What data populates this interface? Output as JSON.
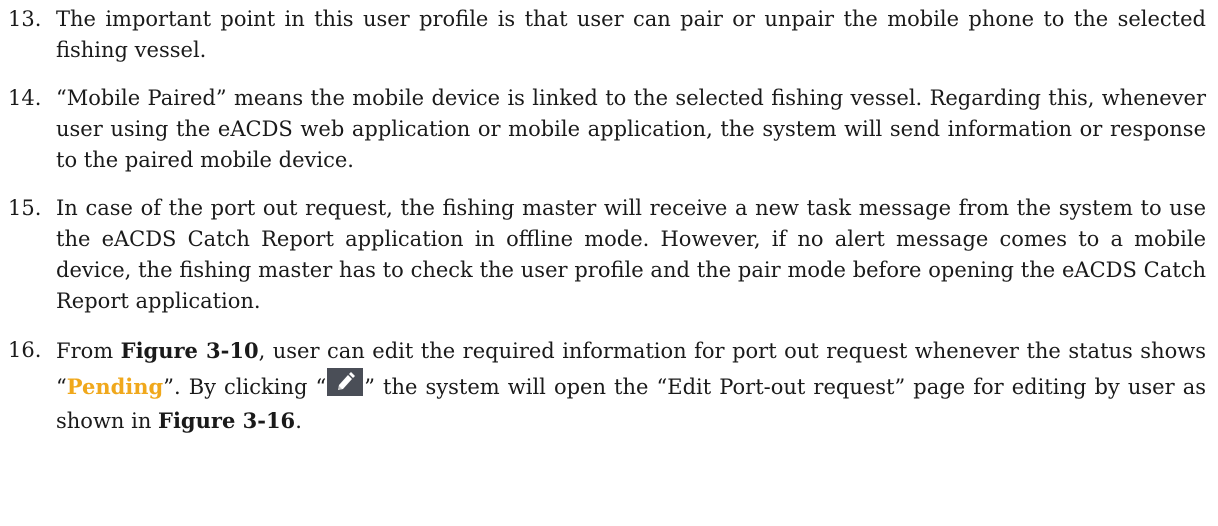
{
  "items": [
    {
      "number": "13.",
      "text": "The important point in this user profile is that user can pair or unpair the mobile phone to the selected fishing vessel."
    },
    {
      "number": "14.",
      "text": "“Mobile Paired” means the mobile device is linked to the selected fishing vessel. Regarding this, whenever user using the eACDS web application or mobile application, the system will send information or response to the paired mobile device."
    },
    {
      "number": "15.",
      "text": "In case of the port out request, the fishing master will receive a new task message from the system to use the eACDS Catch Report application in offline mode. However, if no alert message comes to a mobile device, the fishing master has to check the user profile and the pair mode before opening the eACDS Catch Report application."
    },
    {
      "number": "16.",
      "part1": "From ",
      "figure_ref_1": "Figure 3-10",
      "part2": ", user can edit the required information for port out request whenever the status shows “",
      "status": "Pending",
      "part3": "”. By clicking “",
      "part4": "” the system will open the “Edit Port-out request” page for editing by user as shown in ",
      "figure_ref_2": "Figure 3-16",
      "part5": "."
    }
  ],
  "colors": {
    "pending": "#f0a81c",
    "icon_background": "#4a4e57"
  },
  "icon": "pencil-edit-icon"
}
